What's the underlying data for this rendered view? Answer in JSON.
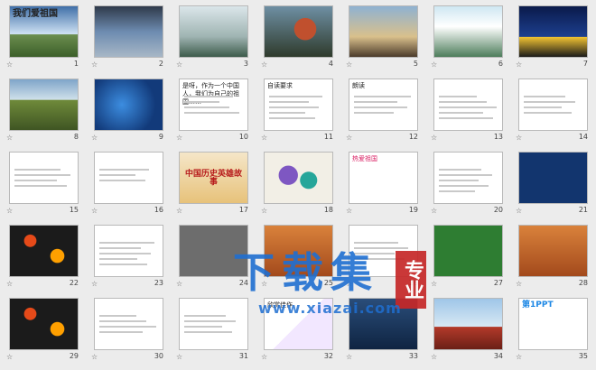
{
  "slides": [
    {
      "n": "1",
      "title": "我们爱祖国",
      "style": "sky",
      "big": true,
      "lines": 0
    },
    {
      "n": "2",
      "title": "",
      "style": "sky2",
      "lines": 0
    },
    {
      "n": "3",
      "title": "",
      "style": "mist",
      "lines": 0
    },
    {
      "n": "4",
      "title": "",
      "style": "tree",
      "lines": 0
    },
    {
      "n": "5",
      "title": "",
      "style": "dusk",
      "lines": 0
    },
    {
      "n": "6",
      "title": "",
      "style": "falls",
      "lines": 0
    },
    {
      "n": "7",
      "title": "",
      "style": "night",
      "lines": 0
    },
    {
      "n": "8",
      "title": "",
      "style": "wall",
      "lines": 0
    },
    {
      "n": "9",
      "title": "",
      "style": "blueglow",
      "lines": 0
    },
    {
      "n": "10",
      "title": "是呀，作为一个中国人，我们为自己的祖国……",
      "style": "",
      "lines": 4
    },
    {
      "n": "11",
      "title": "自读要求",
      "style": "",
      "lines": 5
    },
    {
      "n": "12",
      "title": "朗读",
      "style": "",
      "lines": 4
    },
    {
      "n": "13",
      "title": "",
      "style": "",
      "lines": 5
    },
    {
      "n": "14",
      "title": "",
      "style": "",
      "lines": 4
    },
    {
      "n": "15",
      "title": "",
      "style": "",
      "lines": 4
    },
    {
      "n": "16",
      "title": "",
      "style": "",
      "lines": 3
    },
    {
      "n": "17",
      "title": "中国历史英雄故事",
      "style": "book",
      "lines": 0
    },
    {
      "n": "18",
      "title": "",
      "style": "art",
      "lines": 0
    },
    {
      "n": "19",
      "title": "热爱祖国",
      "style": "pinkt",
      "lines": 0
    },
    {
      "n": "20",
      "title": "",
      "style": "",
      "lines": 5
    },
    {
      "n": "21",
      "title": "",
      "style": "navy",
      "lines": 0
    },
    {
      "n": "22",
      "title": "",
      "style": "fire",
      "lines": 0
    },
    {
      "n": "23",
      "title": "",
      "style": "",
      "lines": 5
    },
    {
      "n": "24",
      "title": "",
      "style": "grayb",
      "lines": 0
    },
    {
      "n": "25",
      "title": "",
      "style": "orange",
      "lines": 0
    },
    {
      "n": "26",
      "title": "",
      "style": "",
      "lines": 4
    },
    {
      "n": "27",
      "title": "",
      "style": "green",
      "lines": 0
    },
    {
      "n": "28",
      "title": "",
      "style": "orange",
      "lines": 0
    },
    {
      "n": "29",
      "title": "",
      "style": "fire",
      "lines": 0
    },
    {
      "n": "30",
      "title": "",
      "style": "",
      "lines": 4
    },
    {
      "n": "31",
      "title": "",
      "style": "",
      "lines": 4
    },
    {
      "n": "32",
      "title": "欣赏佳作",
      "style": "craft",
      "lines": 0
    },
    {
      "n": "33",
      "title": "",
      "style": "dkblue",
      "lines": 0
    },
    {
      "n": "34",
      "title": "",
      "style": "square",
      "lines": 0
    },
    {
      "n": "35",
      "title": "第1PPT",
      "style": "logo",
      "lines": 0
    }
  ],
  "selected_slide": "",
  "watermark": {
    "title": "下载集",
    "seal": "专业",
    "url": "www.xiazai.com"
  }
}
